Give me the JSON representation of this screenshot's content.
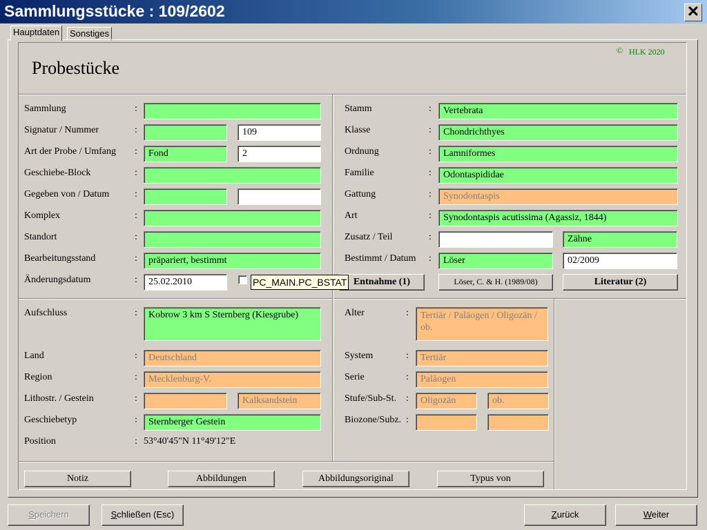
{
  "window": {
    "title": "Sammlungsstücke : 109/2602",
    "close_glyph": "✕"
  },
  "tabs": [
    "Hauptdaten",
    "Sonstiges"
  ],
  "header": {
    "heading": "Probestücke",
    "copyright_symbol": "©",
    "copyright_text": "HLK 2020"
  },
  "colors": {
    "required_field": "#80ff80",
    "derived_field": "#ffc080",
    "free_field": "#ffffff",
    "copyright": "#008000"
  },
  "left": {
    "sammlung": {
      "label": "Sammlung",
      "value": ""
    },
    "signatur": {
      "label": "Signatur / Nummer",
      "value": "",
      "number": "109"
    },
    "art_probe": {
      "label": "Art der Probe / Umfang",
      "value": "Fond",
      "umfang": "2"
    },
    "geschiebe_block": {
      "label": "Geschiebe-Block",
      "value": ""
    },
    "gegeben": {
      "label": "Gegeben von / Datum",
      "value": "",
      "datum": ""
    },
    "komplex": {
      "label": "Komplex",
      "value": ""
    },
    "standort": {
      "label": "Standort",
      "value": ""
    },
    "bearbeitung": {
      "label": "Bearbeitungsstand",
      "value": "präpariert, bestimmt"
    },
    "aenderung": {
      "label": "Änderungsdatum",
      "value": "25.02.2010"
    },
    "tooltip": "PC_MAIN.PC_BSTAT"
  },
  "right": {
    "stamm": {
      "label": "Stamm",
      "value": "Vertebrata"
    },
    "klasse": {
      "label": "Klasse",
      "value": "Chondrichthyes"
    },
    "ordnung": {
      "label": "Ordnung",
      "value": "Lamniformes"
    },
    "familie": {
      "label": "Familie",
      "value": "Odontaspididae"
    },
    "gattung": {
      "label": "Gattung",
      "value": "Synodontaspis"
    },
    "art": {
      "label": "Art",
      "value": "Synodontaspis acutissima (Agassiz, 1844)"
    },
    "zusatz": {
      "label": "Zusatz / Teil",
      "value": "",
      "teil": "Zähne"
    },
    "bestimmt": {
      "label": "Bestimmt / Datum",
      "value": "Löser",
      "datum": "02/2009"
    },
    "buttons": {
      "entnahme": "Entnahme (1)",
      "quelle": "Löser, C. & H. (1989/08)",
      "literatur": "Literatur (2)"
    }
  },
  "location": {
    "aufschluss": {
      "label": "Aufschluss",
      "value": "Kobrow 3 km S Sternberg (Kiesgrube)"
    },
    "land": {
      "label": "Land",
      "value": "Deutschland"
    },
    "region": {
      "label": "Region",
      "value": "Mecklenburg-V."
    },
    "lithostr": {
      "label": "Lithostr. / Gestein",
      "value": "",
      "gestein": "Kalksandstein"
    },
    "geschiebetyp": {
      "label": "Geschiebetyp",
      "value": "Sternberger Gestein"
    },
    "position": {
      "label": "Position",
      "value": "53°40'45\"N 11°49'12\"E"
    }
  },
  "strat": {
    "alter": {
      "label": "Alter",
      "value": "Tertiär / Paläogen / Oligozän / ob."
    },
    "system": {
      "label": "System",
      "value": "Tertiär"
    },
    "serie": {
      "label": "Serie",
      "value": "Paläogen"
    },
    "stufe": {
      "label": "Stufe/Sub-St.",
      "value": "Oligozän",
      "sub": "ob."
    },
    "biozone": {
      "label": "Biozone/Subz.",
      "value": "",
      "sub": ""
    }
  },
  "bottom_buttons": [
    "Notiz",
    "Abbildungen",
    "Abbildungsoriginal",
    "Typus von"
  ],
  "footer": {
    "speichern_first": "S",
    "speichern_rest": "peichern",
    "schliessen_first": "S",
    "schliessen_rest": "chließen (Esc)",
    "zurueck_first": "Z",
    "zurueck_rest": "urück",
    "weiter_first": "W",
    "weiter_rest": "eiter"
  }
}
